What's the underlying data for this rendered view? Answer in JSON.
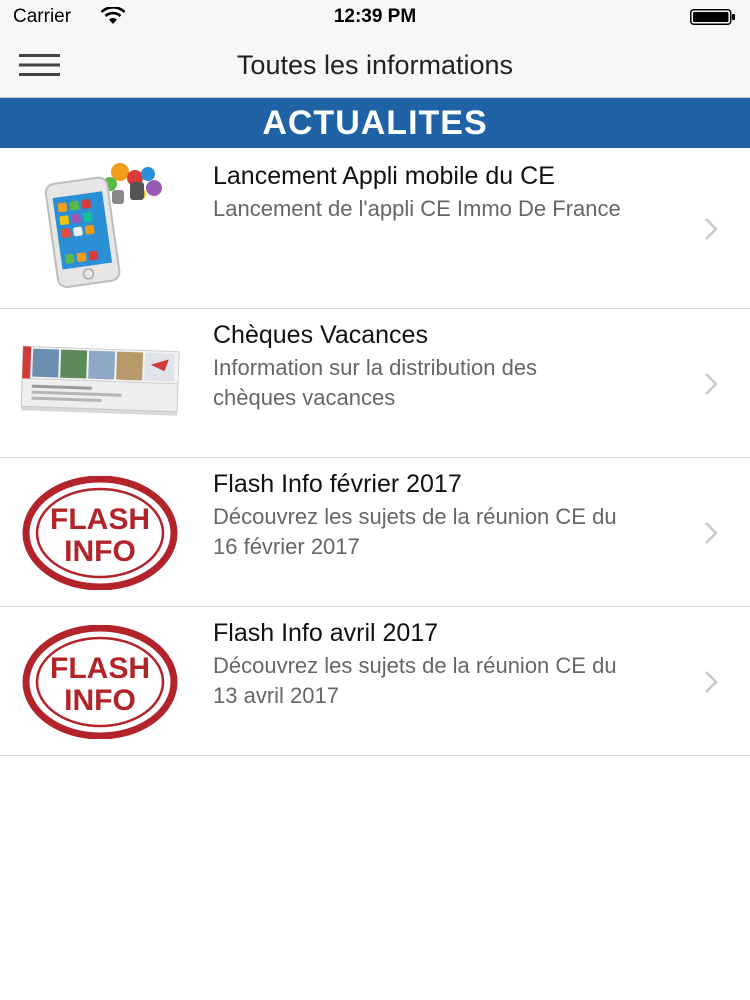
{
  "status_bar": {
    "carrier": "Carrier",
    "time": "12:39 PM"
  },
  "nav": {
    "title": "Toutes les informations",
    "menu_icon": "hamburger-menu-icon"
  },
  "section": {
    "title": "ACTUALITES",
    "color": "#1f63a6"
  },
  "news": [
    {
      "title": "Lancement Appli mobile du CE",
      "description": "Lancement de l'appli CE Immo De France",
      "thumbnail": "smartphone-apps-image"
    },
    {
      "title": "Chèques Vacances",
      "description": "Information sur la distribution des chèques vacances",
      "thumbnail": "cheques-vacances-image"
    },
    {
      "title": "Flash Info février 2017",
      "description": "Découvrez les sujets de la réunion CE du 16 février 2017",
      "thumbnail": "flash-info-stamp-image"
    },
    {
      "title": "Flash Info avril 2017",
      "description": "Découvrez les sujets de la réunion CE du 13 avril 2017",
      "thumbnail": "flash-info-stamp-image"
    }
  ],
  "flash_stamp": {
    "line1": "FLASH",
    "line2": "INFO",
    "color": "#b3232a"
  }
}
